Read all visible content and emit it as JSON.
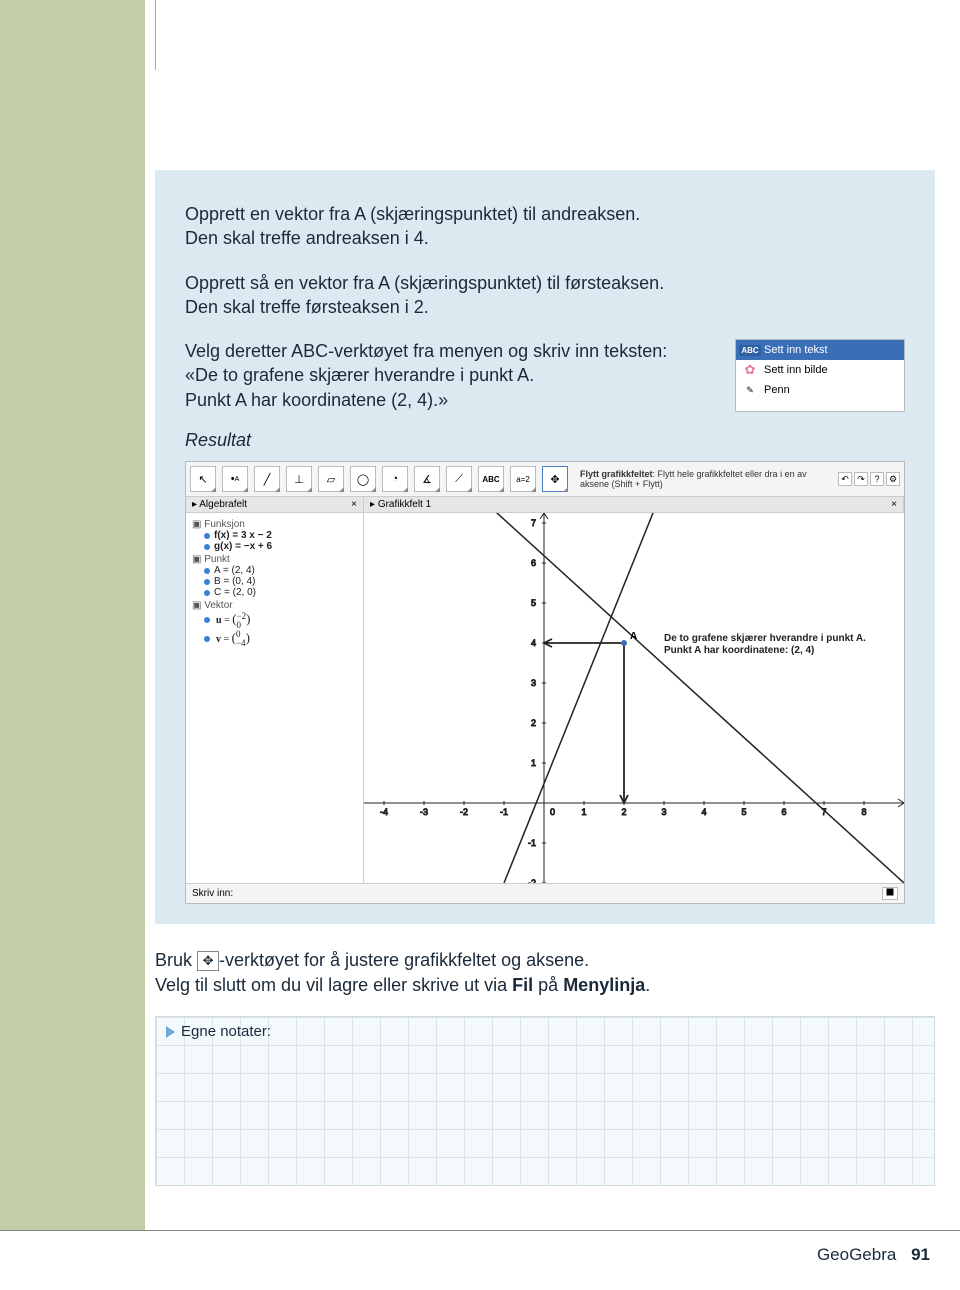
{
  "intro": {
    "p1a": "Opprett en vektor fra A (skjæringspunktet) til andreaksen.",
    "p1b": "Den skal treffe andreaksen i 4.",
    "p2a": "Opprett så en vektor fra A (skjæringspunktet) til førsteaksen.",
    "p2b": "Den skal treffe førsteaksen i 2.",
    "p3a": "Velg deretter ABC-verktøyet fra menyen og skriv inn teksten:",
    "p3b": "«De to grafene skjærer hverandre i punkt A.",
    "p3c": "Punkt A har koordinatene (2, 4).»"
  },
  "menu": {
    "items": [
      {
        "icon": "ABC",
        "label": "Sett inn tekst",
        "selected": true
      },
      {
        "icon": "flower",
        "label": "Sett inn bilde",
        "selected": false
      },
      {
        "icon": "pen",
        "label": "Penn",
        "selected": false
      }
    ]
  },
  "resultat_label": "Resultat",
  "ggb": {
    "tip_bold": "Flytt grafikkfeltet",
    "tip_rest": ": Flytt hele grafikkfeltet eller dra i en av aksene (Shift + Flytt)",
    "algebra_title": "Algebrafelt",
    "graphics_title": "Grafikkfelt 1",
    "algebra": {
      "cat1": "Funksjon",
      "f": "f(x) = 3 x − 2",
      "g": "g(x) = −x + 6",
      "cat2": "Punkt",
      "A": "A = (2, 4)",
      "B": "B = (0, 4)",
      "C": "C = (2, 0)",
      "cat3": "Vektor",
      "u": "u = (−2, 0)",
      "v": "v = (0, −4)"
    },
    "annotation_l1": "De to grafene skjærer hverandre i punkt A.",
    "annotation_l2": "Punkt A har koordinatene: (2, 4)",
    "point_label": "A",
    "input_label": "Skriv inn:"
  },
  "after": {
    "l1a": "Bruk ",
    "l1b": "-verktøyet for å justere grafikkfeltet og aksene.",
    "l2a": "Velg til slutt om du vil lagre eller skrive ut via ",
    "l2b": "Fil",
    "l2c": " på ",
    "l2d": "Menylinja",
    "l2e": "."
  },
  "notes_label": "Egne notater:",
  "footer": {
    "title": "GeoGebra",
    "page": "91"
  },
  "chart_data": {
    "type": "line",
    "title": "",
    "xlabel": "",
    "ylabel": "",
    "xlim": [
      -4,
      8
    ],
    "ylim": [
      -2,
      8
    ],
    "series": [
      {
        "name": "f(x) = 3x − 2",
        "points": [
          [
            -1,
            -5
          ],
          [
            3.3,
            8
          ]
        ]
      },
      {
        "name": "g(x) = −x + 6",
        "points": [
          [
            -2,
            8
          ],
          [
            8,
            -2
          ]
        ]
      }
    ],
    "points": [
      {
        "name": "A",
        "coords": [
          2,
          4
        ]
      },
      {
        "name": "B",
        "coords": [
          0,
          4
        ]
      },
      {
        "name": "C",
        "coords": [
          2,
          0
        ]
      }
    ],
    "vectors": [
      {
        "name": "u",
        "from": [
          2,
          4
        ],
        "to": [
          0,
          4
        ]
      },
      {
        "name": "v",
        "from": [
          2,
          4
        ],
        "to": [
          2,
          0
        ]
      }
    ],
    "annotations": [
      "De to grafene skjærer hverandre i punkt A.",
      "Punkt A har koordinatene: (2, 4)"
    ]
  }
}
